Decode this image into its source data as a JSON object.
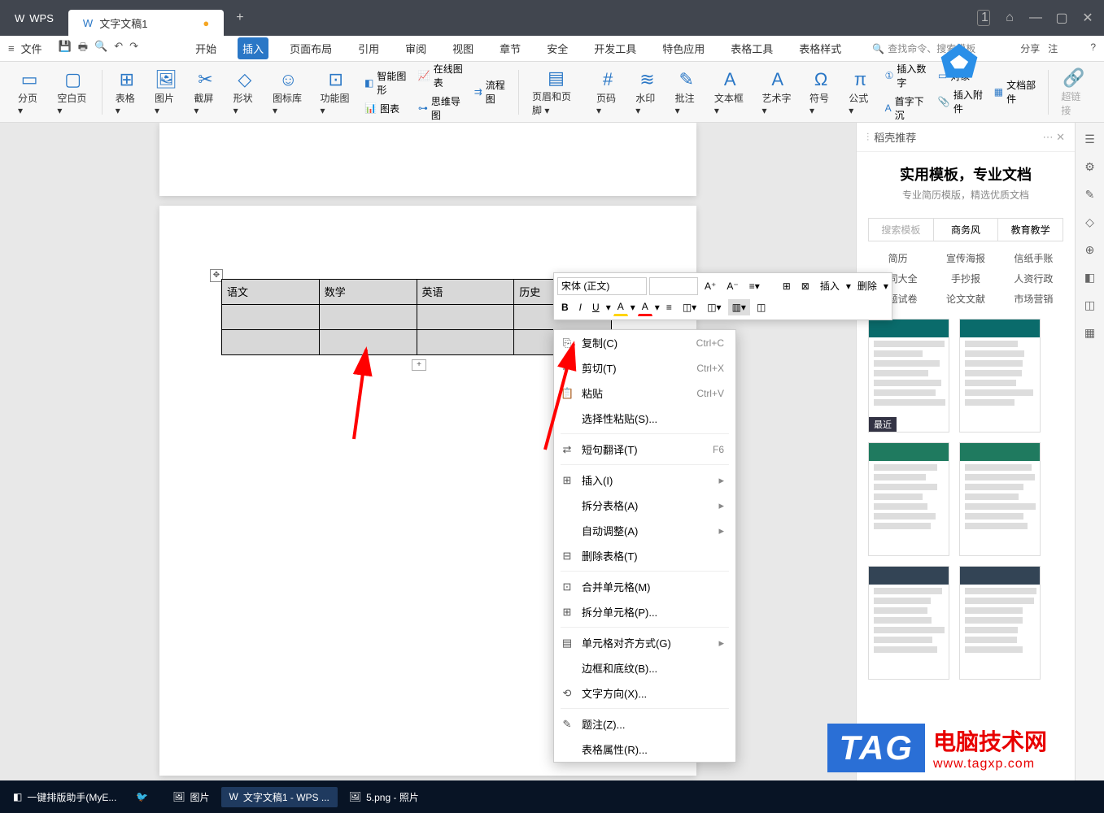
{
  "titlebar": {
    "app": "WPS",
    "doc_tab": "文字文稿1",
    "new_tab": "+",
    "badge": "1"
  },
  "menubar": {
    "file": "文件",
    "tabs": [
      "开始",
      "插入",
      "页面布局",
      "引用",
      "审阅",
      "视图",
      "章节",
      "安全",
      "开发工具",
      "特色应用",
      "表格工具",
      "表格样式"
    ],
    "active_tab_idx": 1,
    "search_placeholder": "查找命令、搜索模板",
    "share": "分享",
    "note": "注"
  },
  "ribbon": {
    "groups_left": [
      {
        "label": "分页",
        "icon": "▭"
      },
      {
        "label": "空白页",
        "icon": "▢"
      },
      {
        "label": "表格",
        "icon": "⊞"
      },
      {
        "label": "图片",
        "icon": "🖼"
      },
      {
        "label": "截屏",
        "icon": "✂"
      },
      {
        "label": "形状",
        "icon": "◇"
      },
      {
        "label": "图标库",
        "icon": "☺"
      },
      {
        "label": "功能图",
        "icon": "⊡"
      }
    ],
    "stack1": [
      {
        "label": "智能图形",
        "icon": "◧"
      },
      {
        "label": "图表",
        "icon": "📊"
      }
    ],
    "stack2": [
      {
        "label": "在线图表",
        "icon": "📈"
      },
      {
        "label": "思维导图",
        "icon": "⊶"
      }
    ],
    "stack3": [
      {
        "label": "流程图",
        "icon": "⇉"
      }
    ],
    "groups_mid": [
      {
        "label": "页眉和页脚",
        "icon": "▤"
      },
      {
        "label": "页码",
        "icon": "#"
      },
      {
        "label": "水印",
        "icon": "≋"
      },
      {
        "label": "批注",
        "icon": "✎"
      },
      {
        "label": "文本框",
        "icon": "A"
      },
      {
        "label": "艺术字",
        "icon": "A"
      },
      {
        "label": "符号",
        "icon": "Ω"
      },
      {
        "label": "公式",
        "icon": "π"
      }
    ],
    "stack_right": [
      {
        "label": "插入数字",
        "icon": "①"
      },
      {
        "label": "首字下沉",
        "icon": "A"
      },
      {
        "label": "对象",
        "icon": "▭"
      },
      {
        "label": "插入附件",
        "icon": "📎"
      },
      {
        "label": "文档部件",
        "icon": "▦"
      }
    ],
    "hyperlink": "超链接"
  },
  "doc_table": {
    "headers": [
      "语文",
      "数学",
      "英语",
      "历史"
    ]
  },
  "mini_toolbar": {
    "font_name": "宋体 (正文)",
    "font_size": "",
    "row1": [
      "A⁺",
      "A⁻",
      "≡",
      "⊞",
      "⊠",
      "插入",
      "删除"
    ],
    "row2": [
      "B",
      "I",
      "U",
      "A",
      "A",
      "≡",
      "◫",
      "◫",
      "▥",
      "◫"
    ]
  },
  "context_menu": [
    {
      "icon": "⎘",
      "label": "复制(C)",
      "shortcut": "Ctrl+C"
    },
    {
      "icon": "✂",
      "label": "剪切(T)",
      "shortcut": "Ctrl+X"
    },
    {
      "icon": "📋",
      "label": "粘贴",
      "shortcut": "Ctrl+V"
    },
    {
      "label": "选择性粘贴(S)..."
    },
    {
      "sep": true
    },
    {
      "icon": "⇄",
      "label": "短句翻译(T)",
      "shortcut": "F6"
    },
    {
      "sep": true
    },
    {
      "icon": "⊞",
      "label": "插入(I)",
      "arrow": true
    },
    {
      "label": "拆分表格(A)",
      "arrow": true
    },
    {
      "label": "自动调整(A)",
      "arrow": true
    },
    {
      "icon": "⊟",
      "label": "删除表格(T)"
    },
    {
      "sep": true
    },
    {
      "icon": "⊡",
      "label": "合并单元格(M)"
    },
    {
      "icon": "⊞",
      "label": "拆分单元格(P)..."
    },
    {
      "sep": true
    },
    {
      "icon": "▤",
      "label": "单元格对齐方式(G)",
      "arrow": true
    },
    {
      "label": "边框和底纹(B)..."
    },
    {
      "icon": "⟲",
      "label": "文字方向(X)..."
    },
    {
      "sep": true
    },
    {
      "icon": "✎",
      "label": "题注(Z)..."
    },
    {
      "label": "表格属性(R)..."
    }
  ],
  "side_panel": {
    "header": "稻壳推荐",
    "title": "实用模板，专业文档",
    "subtitle": "专业简历模版，精选优质文档",
    "search_placeholder": "搜索模板",
    "tabs": [
      "商务风",
      "教育教学"
    ],
    "cats": [
      [
        "简历",
        "宣传海报",
        "信纸手账"
      ],
      [
        "合同大全",
        "手抄报",
        "人资行政"
      ],
      [
        "试题试卷",
        "论文文献",
        "市场营销"
      ]
    ],
    "badge": "最近"
  },
  "rail_icons": [
    "☰",
    "⚙",
    "✎",
    "◇",
    "⊕",
    "◧",
    "◫",
    "▦"
  ],
  "taskbar": {
    "items": [
      {
        "icon": "◧",
        "label": "一键排版助手(MyE..."
      },
      {
        "icon": "🐦",
        "label": ""
      },
      {
        "icon": "🖼",
        "label": "图片"
      },
      {
        "icon": "W",
        "label": "文字文稿1 - WPS ...",
        "active": true
      },
      {
        "icon": "🖼",
        "label": "5.png - 照片"
      }
    ]
  },
  "tag": {
    "box": "TAG",
    "cn": "电脑技术网",
    "url": "www.tagxp.com"
  }
}
